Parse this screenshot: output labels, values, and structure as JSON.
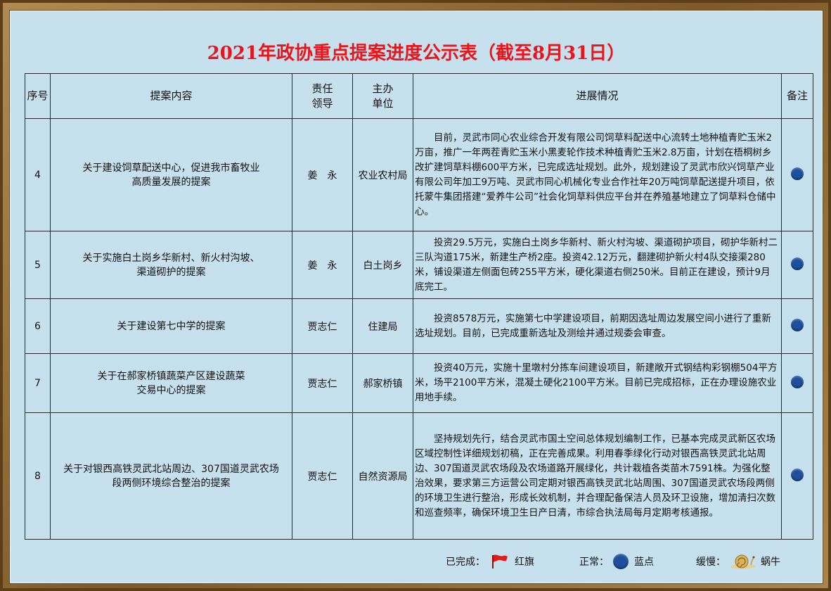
{
  "title": "2021年政协重点提案进度公示表（截至8月31日）",
  "table": {
    "headers": {
      "seq": "序号",
      "content": "提案内容",
      "leader_line1": "责任",
      "leader_line2": "领导",
      "unit_line1": "主办",
      "unit_line2": "单位",
      "progress": "进展情况",
      "note": "备注"
    },
    "rows": [
      {
        "seq": "4",
        "content_line1": "关于建设饲草配送中心，促进我市畜牧业",
        "content_line2": "高质量发展的提案",
        "leader": "姜　永",
        "unit": "农业农村局",
        "progress": "目前，灵武市同心农业综合开发有限公司饲草料配送中心流转土地种植青贮玉米2万亩，推广一年两茬青贮玉米小黑麦轮作技术种植青贮玉米2.8万亩，计划在梧桐树乡改扩建饲草料棚600平方米，已完成选址规划。此外，规划建设了灵武市欣兴饲草产业有限公司年加工9万吨、灵武市同心机械化专业合作社年20万吨饲草配送提升项目，依托蒙牛集团搭建“爱养牛公司”社会化饲草料供应平台并在养殖基地建立了饲草料仓储中心。",
        "status": "normal"
      },
      {
        "seq": "5",
        "content_line1": "关于实施白土岗乡华新村、新火村沟坡、",
        "content_line2": "渠道砌护的提案",
        "leader": "姜　永",
        "unit": "白土岗乡",
        "progress": "投资29.5万元，实施白土岗乡华新村、新火村沟坡、渠道砌护项目，砌护华新村二三队沟道175米，新建生产桥2座。投资42.12万元，翻建砌护新火村4队交接渠280米，铺设渠道左侧面包砖255平方米，硬化渠道右侧250米。目前正在建设，预计9月底完工。",
        "status": "normal"
      },
      {
        "seq": "6",
        "content_line1": "关于建设第七中学的提案",
        "content_line2": "",
        "leader": "贾志仁",
        "unit": "住建局",
        "progress": "投资8578万元，实施第七中学建设项目，前期因选址周边发展空间小进行了重新选址规划。目前，已完成重新选址及测绘并通过规委会审查。",
        "status": "normal"
      },
      {
        "seq": "7",
        "content_line1": "关于在郝家桥镇蔬菜产区建设蔬菜",
        "content_line2": "交易中心的提案",
        "leader": "贾志仁",
        "unit": "郝家桥镇",
        "progress": "投资40万元，实施十里墩村分拣车间建设项目，新建敞开式钢结构彩钢棚504平方米，场平2100平方米，混凝土硬化2100平方米。目前已完成招标，正在办理设施农业用地手续。",
        "status": "normal"
      },
      {
        "seq": "8",
        "content_line1": "关于对银西高铁灵武北站周边、307国道灵武农场",
        "content_line2": "段两侧环境综合整治的提案",
        "leader": "贾志仁",
        "unit": "自然资源局",
        "progress": "坚持规划先行，结合灵武市国土空间总体规划编制工作，已基本完成灵武新区农场区域控制性详细规划初稿，正在完善成果。利用春季绿化行动对银西高铁灵武北站周边、307国道灵武农场段及农场道路开展绿化，共计栽植各类苗木7591株。为强化整治效果，要求第三方运营公司定期对银西高铁灵武北站周围、307国道灵武农场段两侧的环境卫生进行整治，形成长效机制，并合理配备保洁人员及环卫设施，增加清扫次数和巡查频率，确保环境卫生日产日清，市综合执法局每月定期考核通报。",
        "status": "normal"
      }
    ]
  },
  "legend": {
    "done_label": "已完成：",
    "done_symbol": "红旗",
    "normal_label": "正常：",
    "normal_symbol": "蓝点",
    "slow_label": "缓慢：",
    "slow_symbol": "蜗牛"
  },
  "colors": {
    "title": "#e8151a",
    "panel_bg": "#c7e0ee",
    "dot": "#1d4f9c",
    "flag": "#e01b1b"
  }
}
